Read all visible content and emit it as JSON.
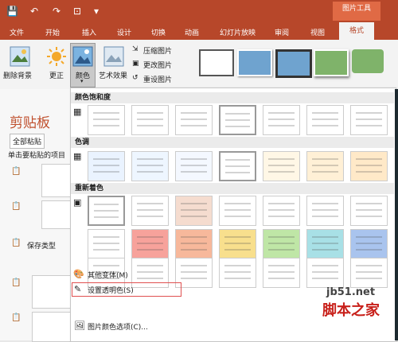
{
  "window": {
    "picture_tools": "图片工具"
  },
  "ribbon_tabs": [
    "文件",
    "开始",
    "插入",
    "设计",
    "切换",
    "动画",
    "幻灯片放映",
    "审阅",
    "视图",
    "格式"
  ],
  "ribbon": {
    "remove_bg": "删除背景",
    "correct": "更正",
    "color": "颜色",
    "artistic": "艺术效果",
    "compress": "压缩图片",
    "change": "更改图片",
    "reset": "重设图片"
  },
  "clipboard": {
    "title": "剪贴板",
    "paste_all": "全部粘贴",
    "paste_hint": "单击要粘贴的项目",
    "save_type": "保存类型"
  },
  "menu": {
    "saturation": "颜色饱和度",
    "tone": "色调",
    "recolor": "重新着色",
    "more_variants": "其他变体(M)",
    "set_transparent": "设置透明色(S)",
    "picture_color_options": "图片颜色选项(C)..."
  },
  "watermark": {
    "site": "jb51.net",
    "name": "脚本之家"
  },
  "colors": {
    "accent": "#b7472a",
    "recolor_row2": [
      "#fff",
      "#f7a29b",
      "#f7b89b",
      "#f8df8d",
      "#bfe6a6",
      "#a8e0e6",
      "#a9c4ee",
      "#e4b4ee"
    ],
    "recolor_row1": [
      "#ffffff",
      "#ffffff",
      "#f5dccf",
      "#ffffff",
      "#ffffff",
      "#ffffff",
      "#ffffff",
      "#ffffff"
    ]
  }
}
